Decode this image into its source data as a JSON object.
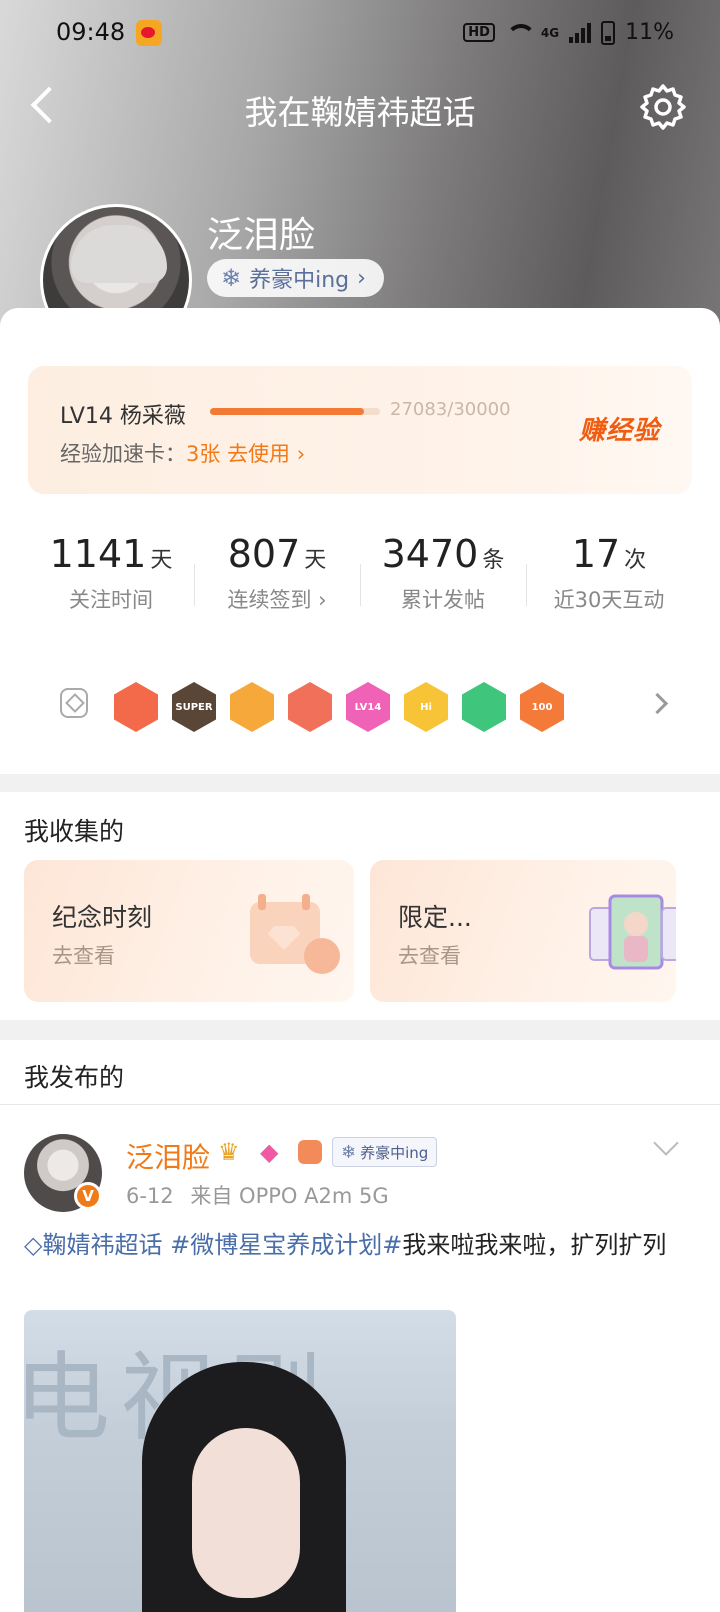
{
  "status_bar": {
    "time": "09:48",
    "network": "HD",
    "signal": "4G",
    "battery": "11%"
  },
  "nav": {
    "title": "我在鞠婧祎超话"
  },
  "profile": {
    "name": "泛泪脸",
    "status": "养豪中ing",
    "verify_mark": "V"
  },
  "level": {
    "name": "LV14 杨采薇",
    "exp": "27083/30000",
    "progress": 0.903,
    "card_label": "经验加速卡：",
    "card_count": "3张",
    "card_action": "去使用",
    "earn": "赚经验"
  },
  "stats": [
    {
      "value": "1141",
      "unit": "天",
      "label": "关注时间"
    },
    {
      "value": "807",
      "unit": "天",
      "label": "连续签到"
    },
    {
      "value": "3470",
      "unit": "条",
      "label": "累计发帖"
    },
    {
      "value": "17",
      "unit": "次",
      "label": "近30天互动"
    }
  ],
  "badges": [
    {
      "name": "dragon-badge",
      "color": "#f36a4a",
      "text": ""
    },
    {
      "name": "super-badge",
      "color": "#5a4636",
      "text": "SUPER"
    },
    {
      "name": "crown-badge",
      "color": "#f6a93a",
      "text": ""
    },
    {
      "name": "mascot-badge",
      "color": "#f0705a",
      "text": ""
    },
    {
      "name": "lv14-badge",
      "color": "#f062b5",
      "text": "LV14"
    },
    {
      "name": "hi-badge",
      "color": "#f8c437",
      "text": "Hi"
    },
    {
      "name": "hand-badge",
      "color": "#3fc57c",
      "text": ""
    },
    {
      "name": "days-badge",
      "color": "#f47a3a",
      "text": "100"
    }
  ],
  "collected": {
    "title": "我收集的",
    "cards": [
      {
        "title": "纪念时刻",
        "sub": "去查看"
      },
      {
        "title": "限定...",
        "sub": "去查看"
      }
    ]
  },
  "posted": {
    "title": "我发布的",
    "post": {
      "author": "泛泪脸",
      "tag": "养豪中ing",
      "date": "6-12",
      "source": "来自 OPPO A2m 5G",
      "topic1": "鞠婧祎超话",
      "topic2": "#微博星宝养成计划#",
      "text": "我来啦我来啦，扩列扩列",
      "image_text": "电视剧"
    }
  },
  "colors": {
    "accent": "#f07a18",
    "topic": "#4a6ea9",
    "progress": "#f37a34"
  }
}
